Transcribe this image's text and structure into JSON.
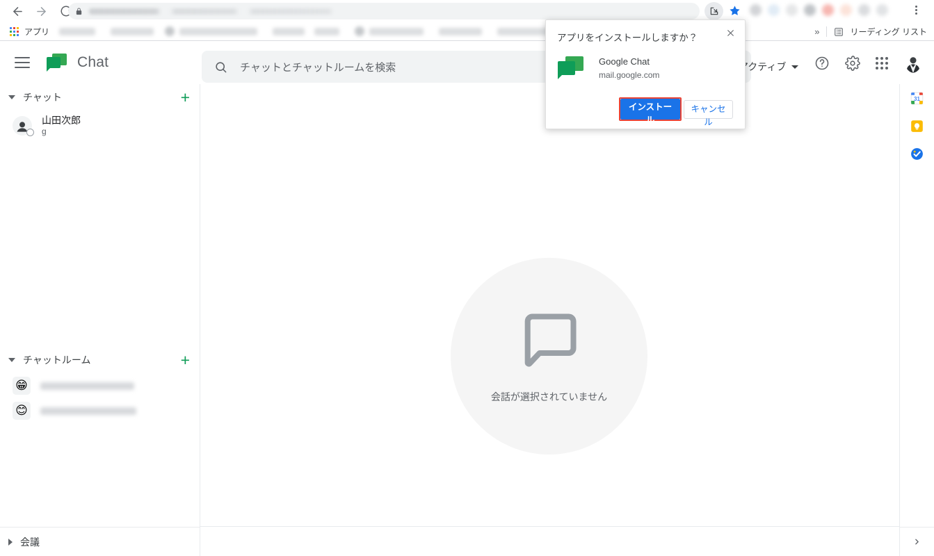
{
  "browser": {
    "back_icon": "back-arrow-icon",
    "forward_icon": "forward-arrow-icon",
    "reload_icon": "reload-icon",
    "lock_icon": "lock-icon",
    "url_value": "",
    "install_icon": "install-app-icon",
    "star_icon": "bookmark-star-icon",
    "menu_icon": "chrome-menu-icon",
    "bookmarks": {
      "apps_label": "アプリ",
      "overflow_label": "»",
      "reading_list_label": "リーディング リスト",
      "reading_list_icon": "reading-list-icon"
    },
    "extension_colors": [
      "#b7babf",
      "#cfe0f0",
      "#d6d8da",
      "#9aa0a6",
      "#f28b82",
      "#fad2c3",
      "#c4c7cb",
      "#cfd2d6"
    ]
  },
  "app_header": {
    "menu_icon": "hamburger-menu-icon",
    "logo_icon": "google-chat-logo",
    "title": "Chat",
    "search": {
      "icon": "search-icon",
      "placeholder": "チャットとチャットルームを検索",
      "value": ""
    },
    "status": {
      "label": "アクティブ",
      "caret_icon": "chevron-down-icon"
    },
    "help_icon": "help-circle-icon",
    "settings_icon": "gear-icon",
    "apps_icon": "apps-grid-icon",
    "avatar_icon": "user-avatar"
  },
  "sidebar": {
    "chat_section": {
      "label": "チャット",
      "expanded": true,
      "add_label": "+",
      "items": [
        {
          "name": "山田次郎",
          "subtitle": "g",
          "avatar": "person-avatar"
        }
      ]
    },
    "rooms_section": {
      "label": "チャットルーム",
      "expanded": true,
      "add_label": "+",
      "items": [
        {
          "emoji": "😁",
          "name": "",
          "width": 135
        },
        {
          "emoji": "😊",
          "name": "",
          "width": 138
        }
      ]
    },
    "meetings_section": {
      "label": "会議",
      "expanded": false
    }
  },
  "main": {
    "empty_state": {
      "icon": "chat-bubble-outline-icon",
      "text": "会話が選択されていません"
    }
  },
  "right_rail": {
    "items": [
      {
        "icon": "google-calendar-icon",
        "label": "31"
      },
      {
        "icon": "google-keep-icon",
        "label": ""
      },
      {
        "icon": "google-tasks-icon",
        "label": ""
      }
    ],
    "expand_icon": "chevron-right-icon"
  },
  "install_dialog": {
    "title": "アプリをインストールしますか？",
    "close_icon": "close-icon",
    "app_logo_icon": "google-chat-logo",
    "app_name": "Google Chat",
    "app_url": "mail.google.com",
    "install_label": "インストール",
    "cancel_label": "キャンセル",
    "highlight_color": "#ea4335",
    "primary_color": "#1a73e8"
  }
}
